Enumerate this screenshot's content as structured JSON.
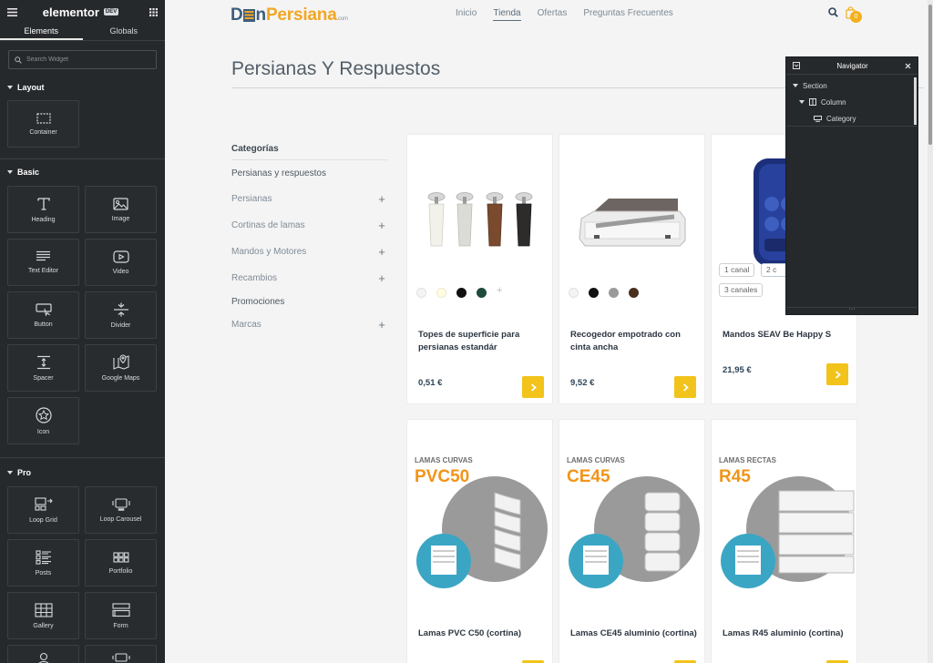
{
  "editor": {
    "brand": "elementor",
    "brand_badge": "DEV",
    "tabs": [
      "Elements",
      "Globals"
    ],
    "search_placeholder": "Search Widget",
    "categories": {
      "layout": {
        "label": "Layout",
        "widgets": [
          {
            "label": "Container",
            "icon": "container-icon"
          }
        ]
      },
      "basic": {
        "label": "Basic",
        "widgets": [
          {
            "label": "Heading",
            "icon": "heading-icon"
          },
          {
            "label": "Image",
            "icon": "image-icon"
          },
          {
            "label": "Text Editor",
            "icon": "text-editor-icon"
          },
          {
            "label": "Video",
            "icon": "video-icon"
          },
          {
            "label": "Button",
            "icon": "button-icon"
          },
          {
            "label": "Divider",
            "icon": "divider-icon"
          },
          {
            "label": "Spacer",
            "icon": "spacer-icon"
          },
          {
            "label": "Google Maps",
            "icon": "google-maps-icon"
          },
          {
            "label": "Icon",
            "icon": "star-icon"
          }
        ]
      },
      "pro": {
        "label": "Pro",
        "widgets": [
          {
            "label": "Loop Grid",
            "icon": "loop-grid-icon"
          },
          {
            "label": "Loop Carousel",
            "icon": "loop-carousel-icon"
          },
          {
            "label": "Posts",
            "icon": "posts-icon"
          },
          {
            "label": "Portfolio",
            "icon": "portfolio-icon"
          },
          {
            "label": "Gallery",
            "icon": "gallery-icon"
          },
          {
            "label": "Form",
            "icon": "form-icon"
          }
        ]
      }
    }
  },
  "site": {
    "logo": {
      "part1": "D",
      "part2": "n",
      "part3": "Persiana",
      "suffix": ".com"
    },
    "nav": [
      "Inicio",
      "Tienda",
      "Ofertas",
      "Preguntas Frecuentes"
    ],
    "active_nav": "Tienda",
    "cart_count": "0",
    "page_title": "Persianas Y Respuestos",
    "categories_heading": "Categorías",
    "categories": [
      {
        "label": "Persianas y respuestos",
        "expandable": false,
        "dark": true
      },
      {
        "label": "Persianas",
        "expandable": true
      },
      {
        "label": "Cortinas de lamas",
        "expandable": true
      },
      {
        "label": "Mandos y Motores",
        "expandable": true
      },
      {
        "label": "Recambios",
        "expandable": true
      },
      {
        "label": "Promociones",
        "expandable": false,
        "dark": true
      },
      {
        "label": "Marcas",
        "expandable": true
      }
    ],
    "products": [
      {
        "name_l1": "Topes de superficie para",
        "name_l2": "persianas estandár",
        "price": "0,51 €",
        "swatches": [
          "#f4f4f4",
          "#fffde0",
          "#111111",
          "#1e4a3c"
        ],
        "more": "+"
      },
      {
        "name_l1": "Recogedor empotrado con",
        "name_l2": "cinta ancha",
        "price": "9,52 €",
        "swatches": [
          "#f4f4f4",
          "#111111",
          "#9a9a9a",
          "#4a2e1e"
        ]
      },
      {
        "name_l1": "Mandos SEAV Be Happy S",
        "name_l2": "",
        "price": "21,95 €",
        "options": [
          "1 canal",
          "2 c",
          "3 canales"
        ]
      },
      {
        "name_l1": "Lamas PVC C50 (cortina)",
        "lamas_label": "LAMAS CURVAS",
        "lamas_code": "PVC50"
      },
      {
        "name_l1": "Lamas CE45 aluminio (cortina)",
        "lamas_label": "LAMAS CURVAS",
        "lamas_code": "CE45"
      },
      {
        "name_l1": "Lamas R45 aluminio (cortina)",
        "lamas_label": "LAMAS RECTAS",
        "lamas_code": "R45"
      }
    ]
  },
  "navigator": {
    "title": "Navigator",
    "tree": [
      {
        "label": "Section",
        "icon": "caret-down-icon"
      },
      {
        "label": "Column",
        "icon": "column-icon"
      },
      {
        "label": "Category",
        "icon": "widget-icon"
      }
    ]
  }
}
